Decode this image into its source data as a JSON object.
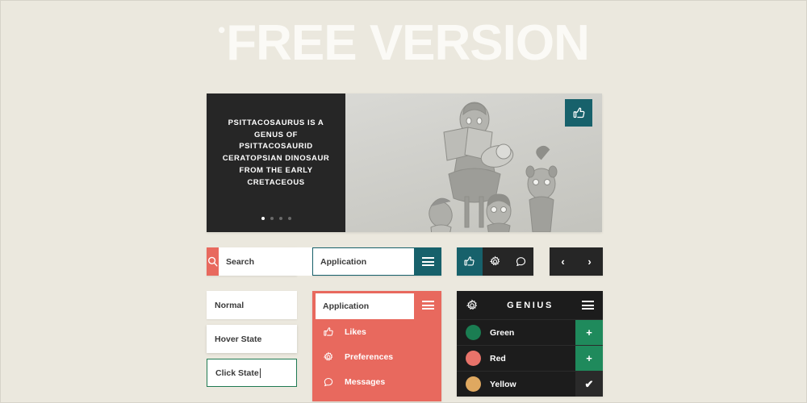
{
  "page": {
    "background_color": "#ebe8de",
    "hero_title": "FREE VERSION",
    "hero_title_bullet": "•"
  },
  "banner": {
    "copy": "Psittacosaurus is a genus of psittacosaurid ceratopsian dinosaur from the Early Cretaceous",
    "like_button_icon": "thumbs-up-icon",
    "carousel_dots": 4,
    "carousel_active_index": 0,
    "accent_color": "#17616b",
    "panel_color": "#262626"
  },
  "search": {
    "value": "Search",
    "placeholder": "Search",
    "icon": "search-icon",
    "accent_color": "#e8695e"
  },
  "app_select": {
    "value": "Application",
    "menu_icon": "hamburger-icon",
    "accent_color": "#17616b"
  },
  "icon_group": {
    "buttons": [
      {
        "name": "like-button",
        "icon": "thumbs-up-icon",
        "active": true
      },
      {
        "name": "settings-button",
        "icon": "gear-icon",
        "active": false
      },
      {
        "name": "messages-button",
        "icon": "chat-bubble-icon",
        "active": false
      }
    ],
    "active_color": "#17616b",
    "inactive_color": "#262626"
  },
  "arrow_group": {
    "prev_label": "‹",
    "next_label": "›",
    "background_color": "#262626"
  },
  "input_states": [
    {
      "label": "Normal",
      "state": "normal"
    },
    {
      "label": "Hover State",
      "state": "hover"
    },
    {
      "label": "Click State",
      "state": "click"
    }
  ],
  "dropdown": {
    "header_value": "Application",
    "menu_icon": "hamburger-icon",
    "background_color": "#e8695e",
    "items": [
      {
        "label": "Likes",
        "icon": "thumbs-up-icon"
      },
      {
        "label": "Preferences",
        "icon": "gear-icon"
      },
      {
        "label": "Messages",
        "icon": "chat-bubble-icon"
      }
    ]
  },
  "genius": {
    "title": "GENIUS",
    "settings_icon": "gear-icon",
    "menu_icon": "hamburger-icon",
    "background_color": "#1c1c1c",
    "rows": [
      {
        "label": "Green",
        "swatch_color": "#1a7d52",
        "action": "+",
        "action_type": "add"
      },
      {
        "label": "Red",
        "swatch_color": "#e8736a",
        "action": "+",
        "action_type": "add"
      },
      {
        "label": "Yellow",
        "swatch_color": "#dfa860",
        "action": "✔",
        "action_type": "check"
      }
    ]
  }
}
